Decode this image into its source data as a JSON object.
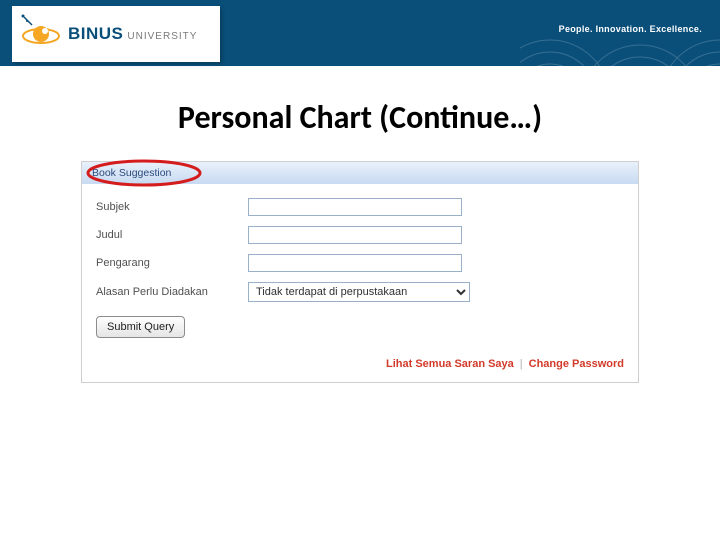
{
  "banner": {
    "brand_bold": "BINUS",
    "brand_light": "UNIVERSITY",
    "tagline": "People. Innovation. Excellence."
  },
  "page": {
    "title": "Personal Chart (Continue…)"
  },
  "form": {
    "panel_title": "Book Suggestion",
    "rows": {
      "subject_label": "Subjek",
      "title_label": "Judul",
      "author_label": "Pengarang",
      "reason_label": "Alasan Perlu Diadakan",
      "reason_selected": "Tidak terdapat di perpustakaan"
    },
    "submit_label": "Submit Query",
    "footer": {
      "link1": "Lihat Semua Saran Saya",
      "separator": "|",
      "link2": "Change Password"
    }
  }
}
